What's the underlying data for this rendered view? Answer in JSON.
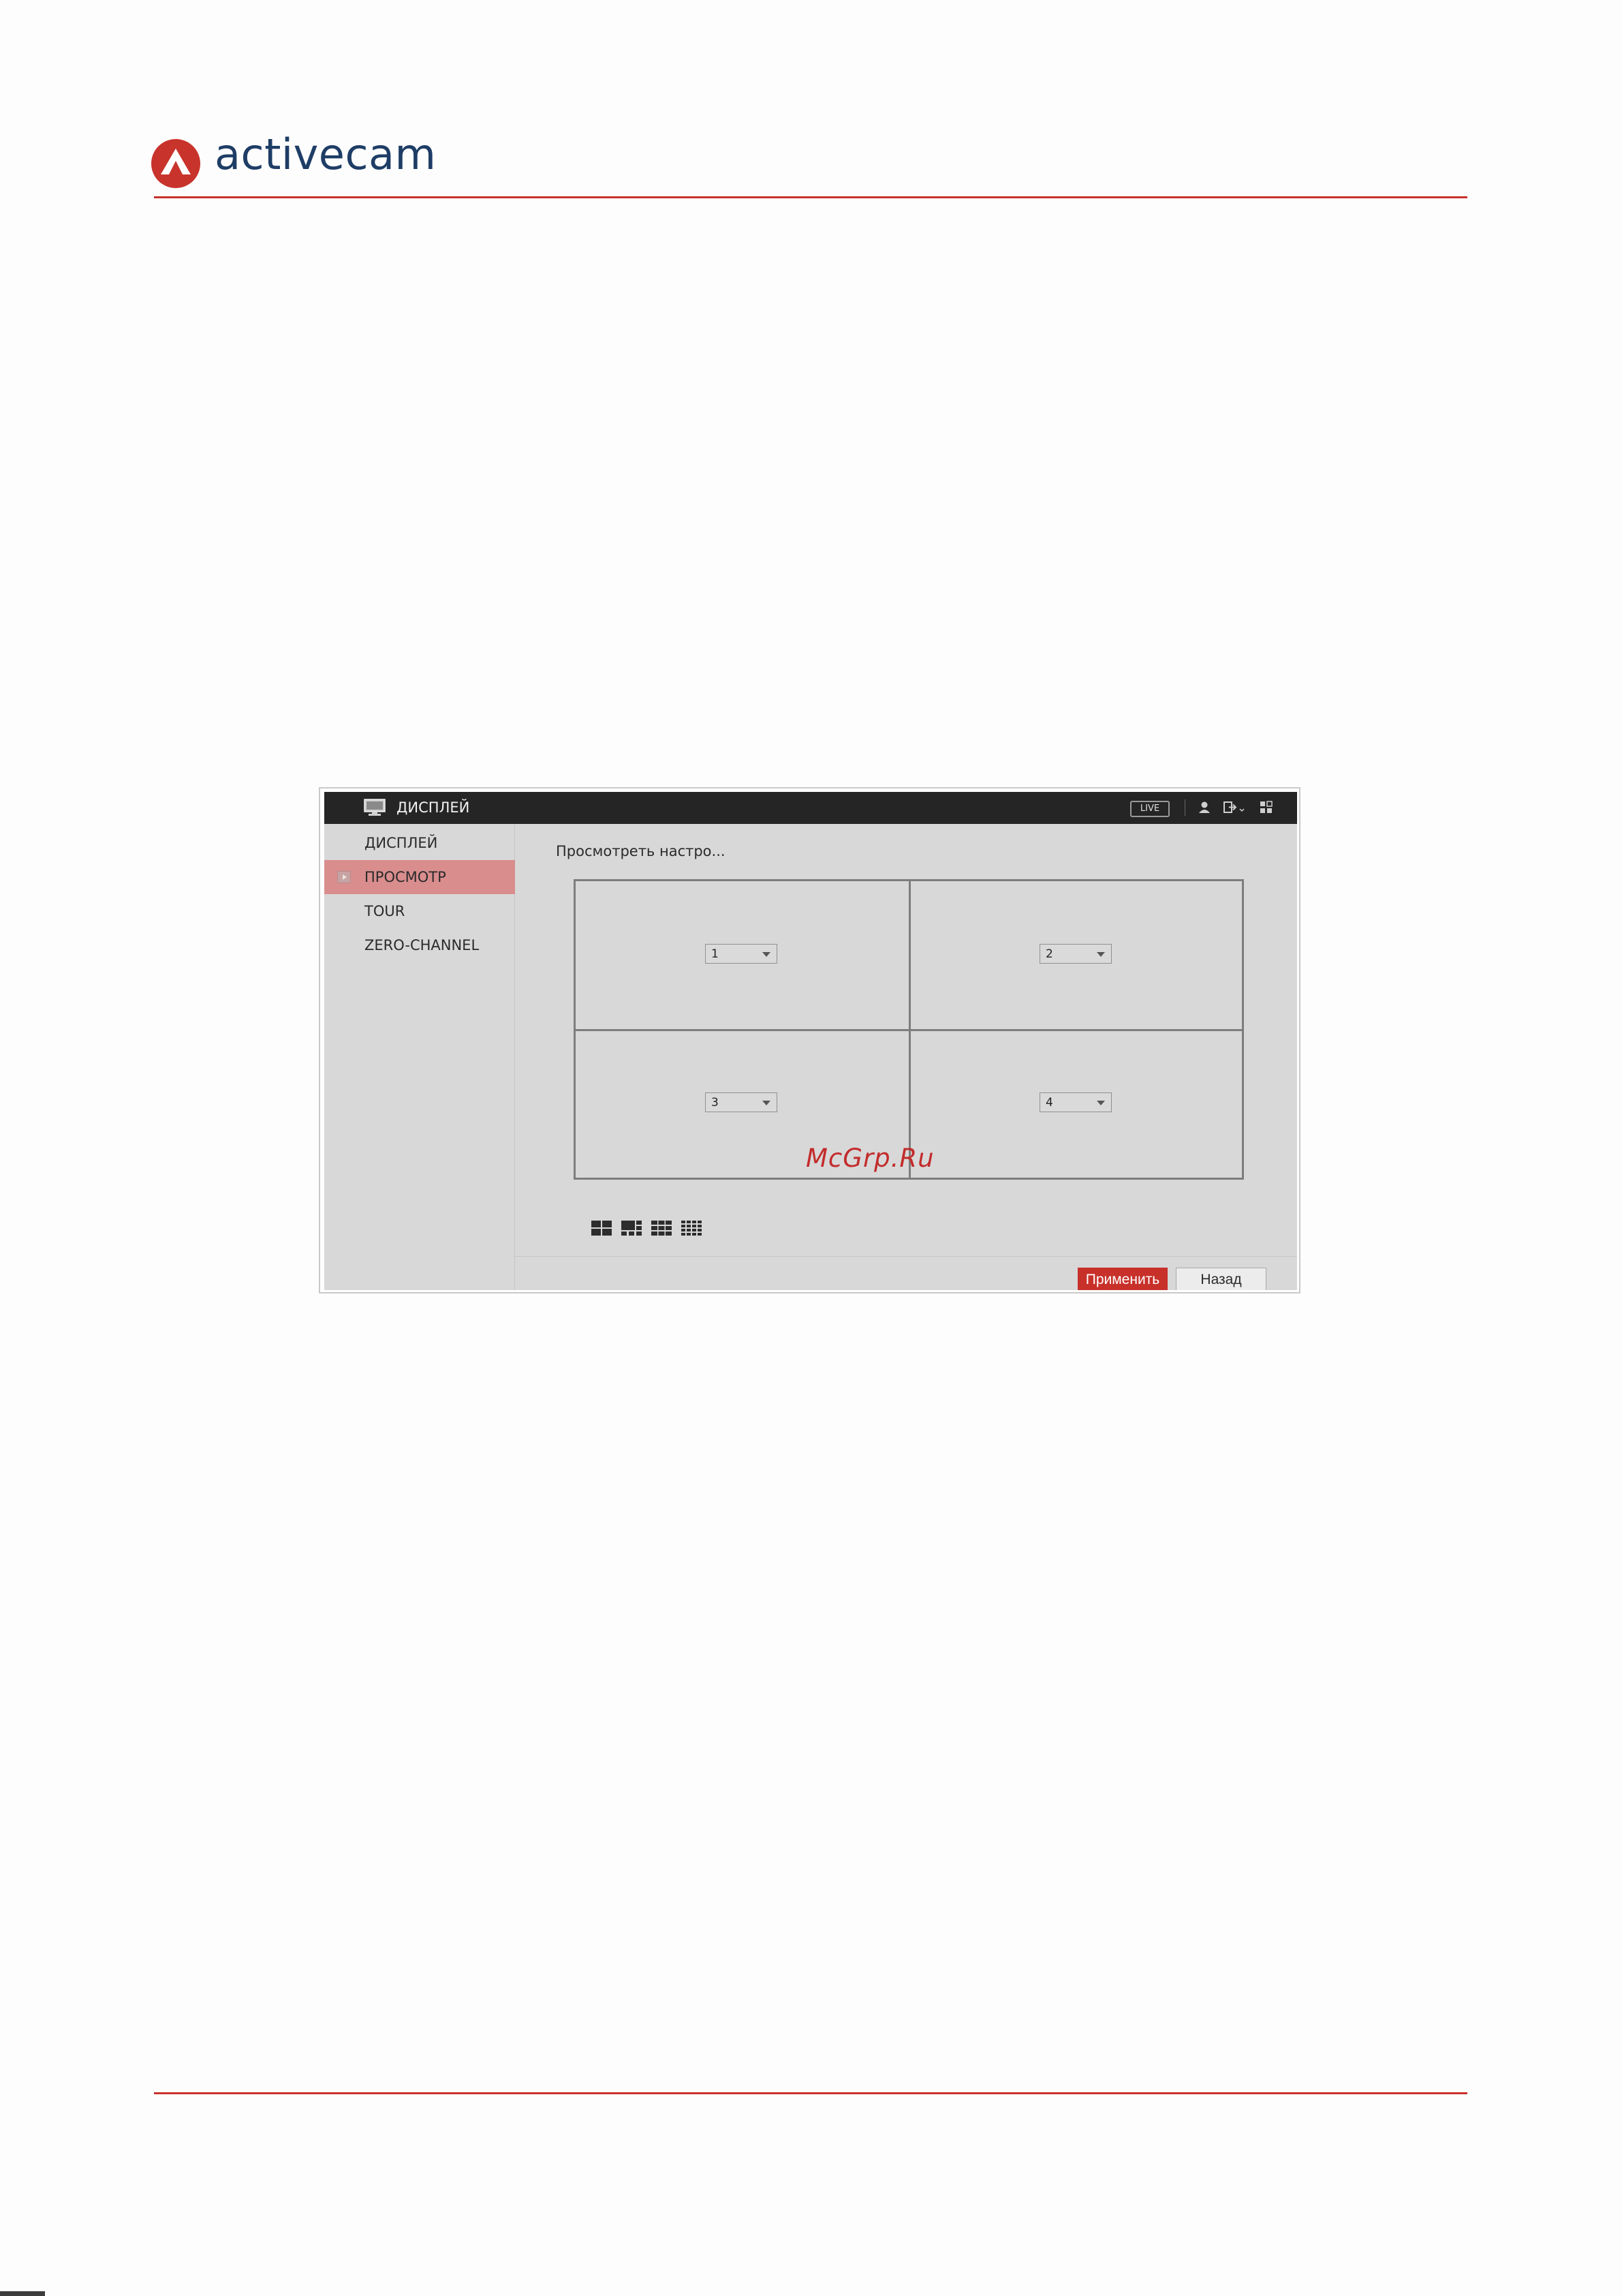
{
  "brand": {
    "name": "activecam"
  },
  "window": {
    "title": "ДИСПЛЕЙ",
    "live_badge": "LIVE"
  },
  "sidebar": {
    "items": [
      {
        "label": "ДИСПЛЕЙ",
        "active": false
      },
      {
        "label": "ПРОСМОТР",
        "active": true
      },
      {
        "label": "TOUR",
        "active": false
      },
      {
        "label": "ZERO-CHANNEL",
        "active": false
      }
    ]
  },
  "content": {
    "section_label": "Просмотреть настро...",
    "cells": [
      {
        "value": "1"
      },
      {
        "value": "2"
      },
      {
        "value": "3"
      },
      {
        "value": "4"
      }
    ],
    "layout_options": [
      "4-split",
      "6-split",
      "8-split",
      "16-split"
    ]
  },
  "watermark": "McGrp.Ru",
  "buttons": {
    "apply": "Применить",
    "back": "Назад"
  },
  "colors": {
    "accent": "#c8302a",
    "brand_blue": "#1e3d66",
    "active_item": "#d98d8d",
    "titlebar": "#252525"
  },
  "icons": [
    "monitor-icon",
    "user-icon",
    "logout-icon",
    "grid-icon",
    "play-marker-icon"
  ]
}
